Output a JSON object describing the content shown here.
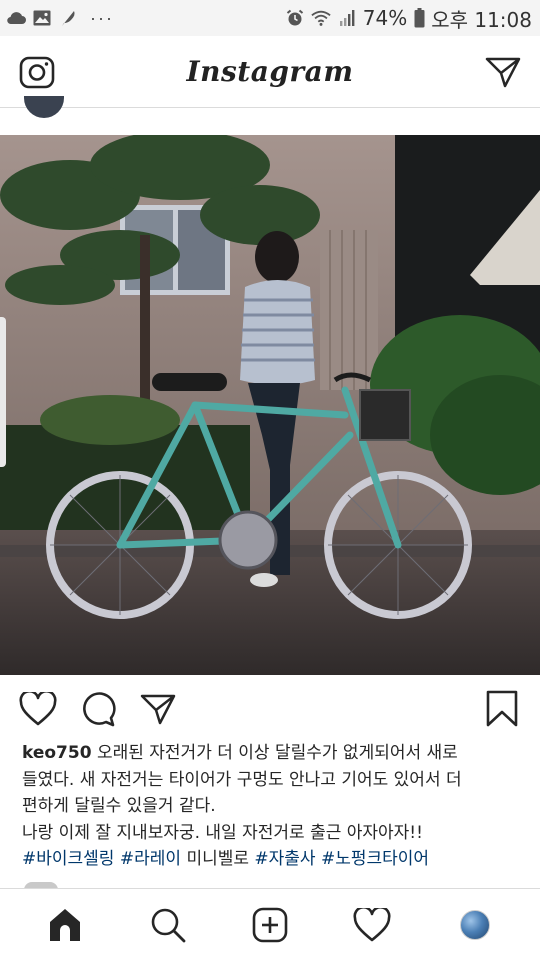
{
  "status_bar": {
    "battery_percent": "74%",
    "time": "오후 11:08",
    "icons_left": [
      "cloud-icon",
      "image-icon",
      "feather-icon",
      "more-dots-icon"
    ],
    "icons_right": [
      "alarm-icon",
      "wifi-icon",
      "signal-icon",
      "battery-icon"
    ],
    "dots": "···"
  },
  "header": {
    "brand": "Instagram",
    "left_icon": "camera-icon",
    "right_icon": "direct-message-icon"
  },
  "post": {
    "photo_icon": "bicycle-photo",
    "actions": [
      "like-icon",
      "comment-icon",
      "share-icon",
      "save-icon"
    ],
    "caption": {
      "username": "keo750",
      "line1": "오래된 자전거가 더 이상 달릴수가 없게되어서 새로",
      "line2": "들였다. 새 자전거는 타이어가 구멍도 안나고 기어도 있어서 더",
      "line3": "편하게 달릴수 있을거 같다.",
      "line4": "나랑 이제 잘 지내보자궁. 내일 자전거로 출근 아자아자!!",
      "hashtags": [
        "#바이크셀링",
        "#라레이",
        "#자출사",
        "#노펑크타이어"
      ],
      "plain_between": "미니벨로"
    }
  },
  "bottom_nav": [
    "home-icon",
    "search-icon",
    "add-post-icon",
    "activity-icon",
    "profile-avatar"
  ],
  "colors": {
    "hashtag": "#00376b",
    "status_bar_bg": "#f4f4f4",
    "divider": "#dbdbdb"
  }
}
